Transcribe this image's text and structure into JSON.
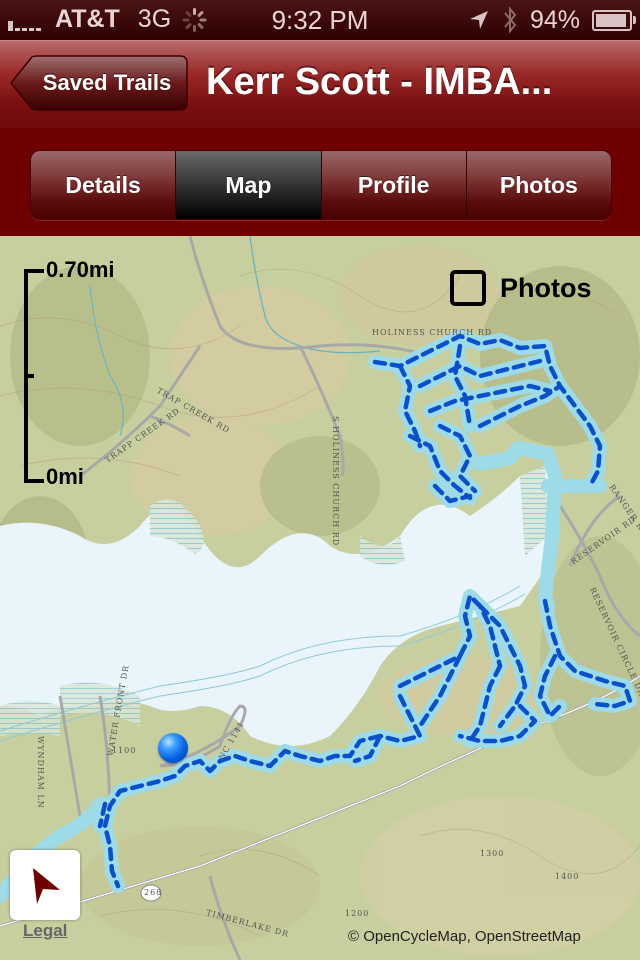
{
  "status_bar": {
    "carrier": "AT&T",
    "network": "3G",
    "time": "9:32 PM",
    "battery_percent_label": "94%",
    "battery_level": 0.94,
    "icons": [
      "signal-icon",
      "activity-spinner-icon",
      "location-arrow-icon",
      "bluetooth-icon",
      "battery-icon"
    ]
  },
  "nav": {
    "back_label": "Saved Trails",
    "title": "Kerr Scott - IMBA..."
  },
  "tabs": [
    {
      "label": "Details",
      "active": false
    },
    {
      "label": "Map",
      "active": true
    },
    {
      "label": "Profile",
      "active": false
    },
    {
      "label": "Photos",
      "active": false
    }
  ],
  "map": {
    "scale_top": "0.70mi",
    "scale_bottom": "0mi",
    "photos_toggle_label": "Photos",
    "photos_toggle_checked": false,
    "legal_label": "Legal",
    "attribution": "© OpenCycleMap, OpenStreetMap",
    "labels": [
      "HOLINESS CHURCH RD",
      "S HOLINESS CHURCH RD",
      "TRAPP CREEK RD",
      "TRAP CREEK RD",
      "WATER FRONT DR",
      "WYNDHAM LN",
      "NC 1141",
      "TIMBERLAKE DR",
      "RESERVOIR RD",
      "RANGER RD",
      "RESERVOIR CIRCLE DR",
      "268",
      "1100",
      "1200",
      "1300",
      "1400"
    ],
    "colors": {
      "water": "#eaf5fb",
      "trail_halo": "#9edbe8",
      "trail_dash": "#0a4fcc",
      "location_dot": "#1a7ae8",
      "locate_arrow": "#6e0000"
    }
  }
}
